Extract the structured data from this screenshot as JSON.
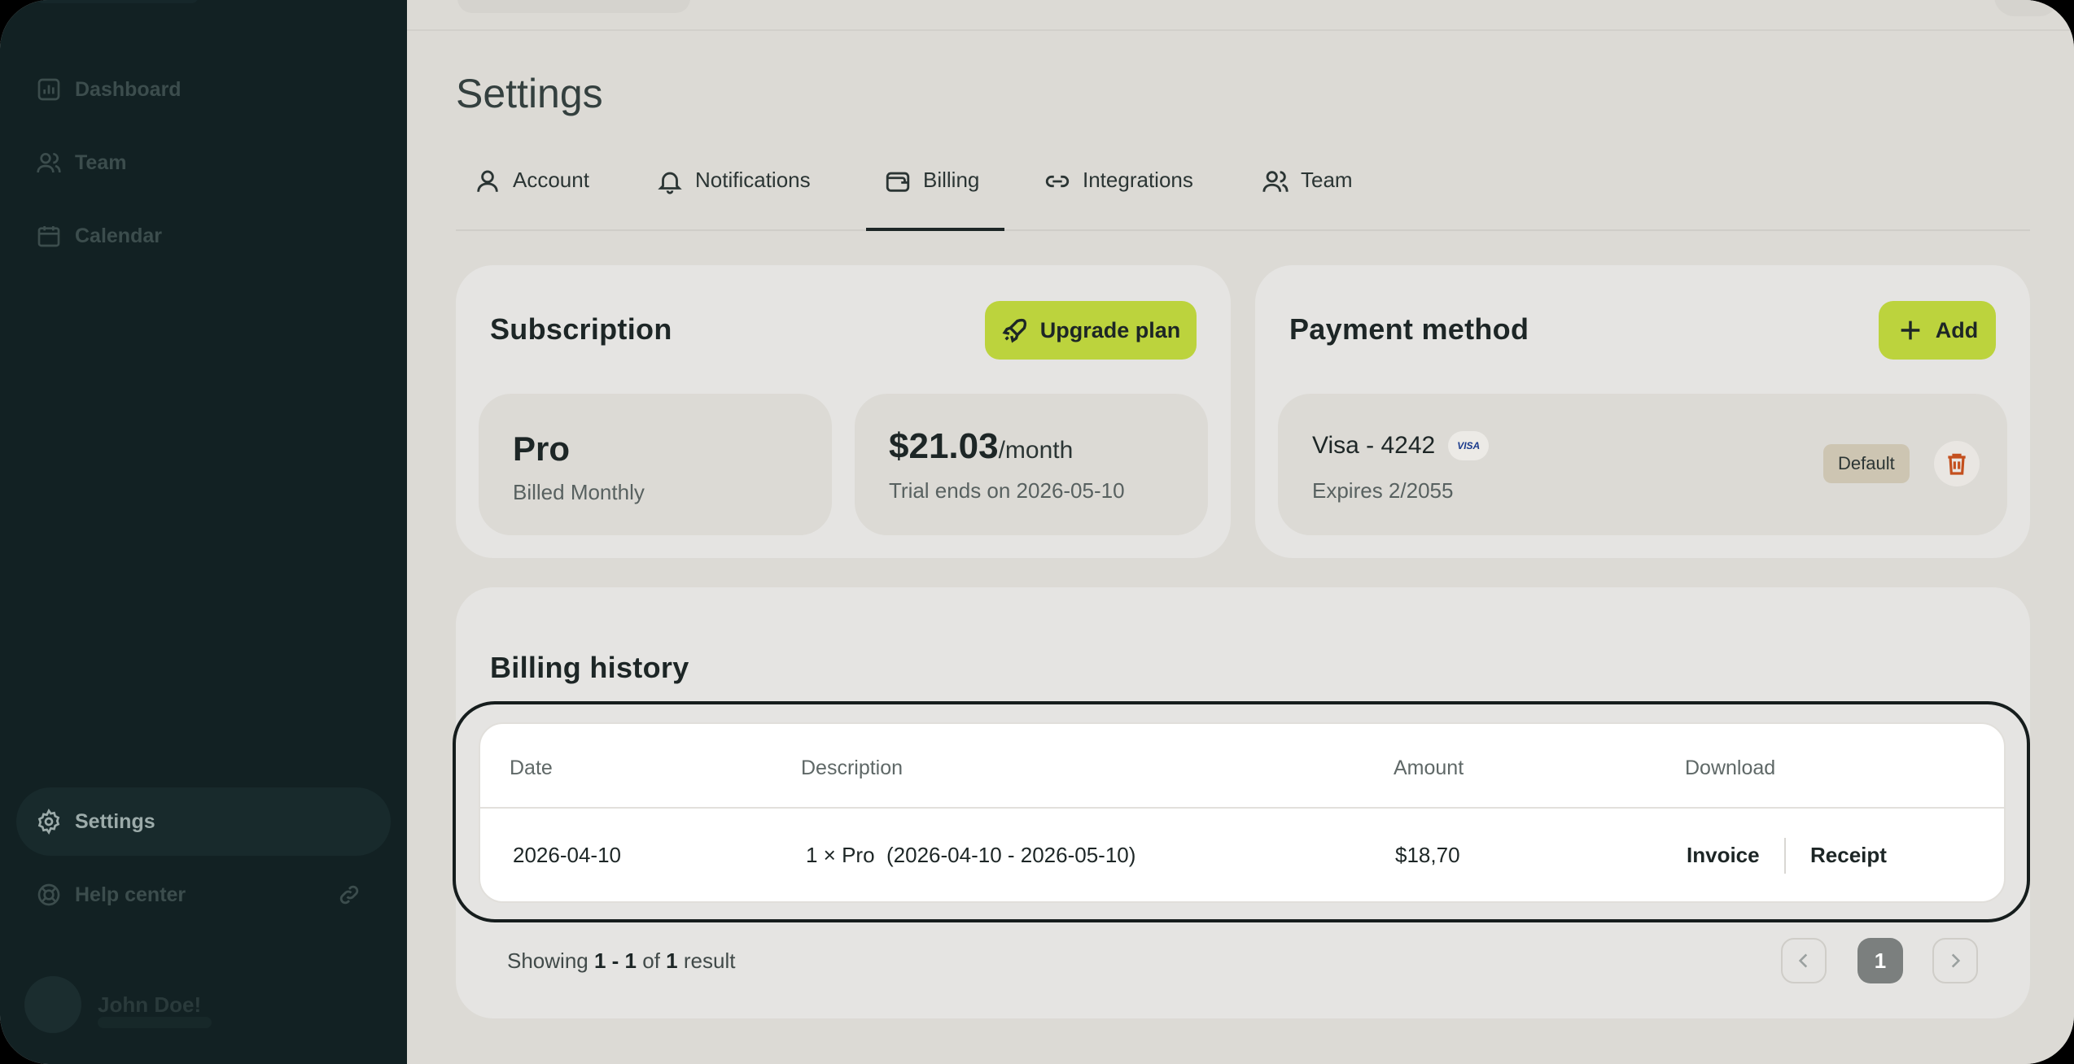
{
  "sidebar": {
    "items": [
      {
        "label": "Dashboard",
        "icon": "chart-icon"
      },
      {
        "label": "Team",
        "icon": "users-icon"
      },
      {
        "label": "Calendar",
        "icon": "calendar-icon"
      }
    ],
    "bottom": [
      {
        "label": "Settings",
        "icon": "gear-icon",
        "active": true
      },
      {
        "label": "Help center",
        "icon": "lifebuoy-icon"
      }
    ],
    "user": {
      "name": "John Doe!"
    }
  },
  "page": {
    "title": "Settings"
  },
  "tabs": [
    {
      "label": "Account",
      "icon": "user-icon"
    },
    {
      "label": "Notifications",
      "icon": "bell-icon"
    },
    {
      "label": "Billing",
      "icon": "wallet-icon",
      "active": true
    },
    {
      "label": "Integrations",
      "icon": "link-icon"
    },
    {
      "label": "Team",
      "icon": "users-icon"
    }
  ],
  "subscription": {
    "title": "Subscription",
    "upgrade_label": "Upgrade plan",
    "plan_name": "Pro",
    "plan_billing": "Billed Monthly",
    "price": "$21.03",
    "price_period": "/month",
    "trial_text": "Trial ends on 2026-05-10"
  },
  "payment": {
    "title": "Payment method",
    "add_label": "Add",
    "card_label": "Visa - 4242",
    "card_brand": "VISA",
    "expires": "Expires 2/2055",
    "default_badge": "Default"
  },
  "history": {
    "title": "Billing history",
    "columns": [
      "Date",
      "Description",
      "Amount",
      "Download"
    ],
    "rows": [
      {
        "date": "2026-04-10",
        "description": "1 × Pro  (2026-04-10 - 2026-05-10)",
        "amount": "$18,70",
        "invoice": "Invoice",
        "receipt": "Receipt"
      }
    ],
    "showing_prefix": "Showing",
    "showing_range": "1 - 1",
    "showing_of": "of",
    "showing_total": "1",
    "showing_suffix": "result",
    "current_page": "1"
  },
  "colors": {
    "accent": "#bcd33d",
    "sidebar": "#122123",
    "danger": "#c4501e"
  }
}
